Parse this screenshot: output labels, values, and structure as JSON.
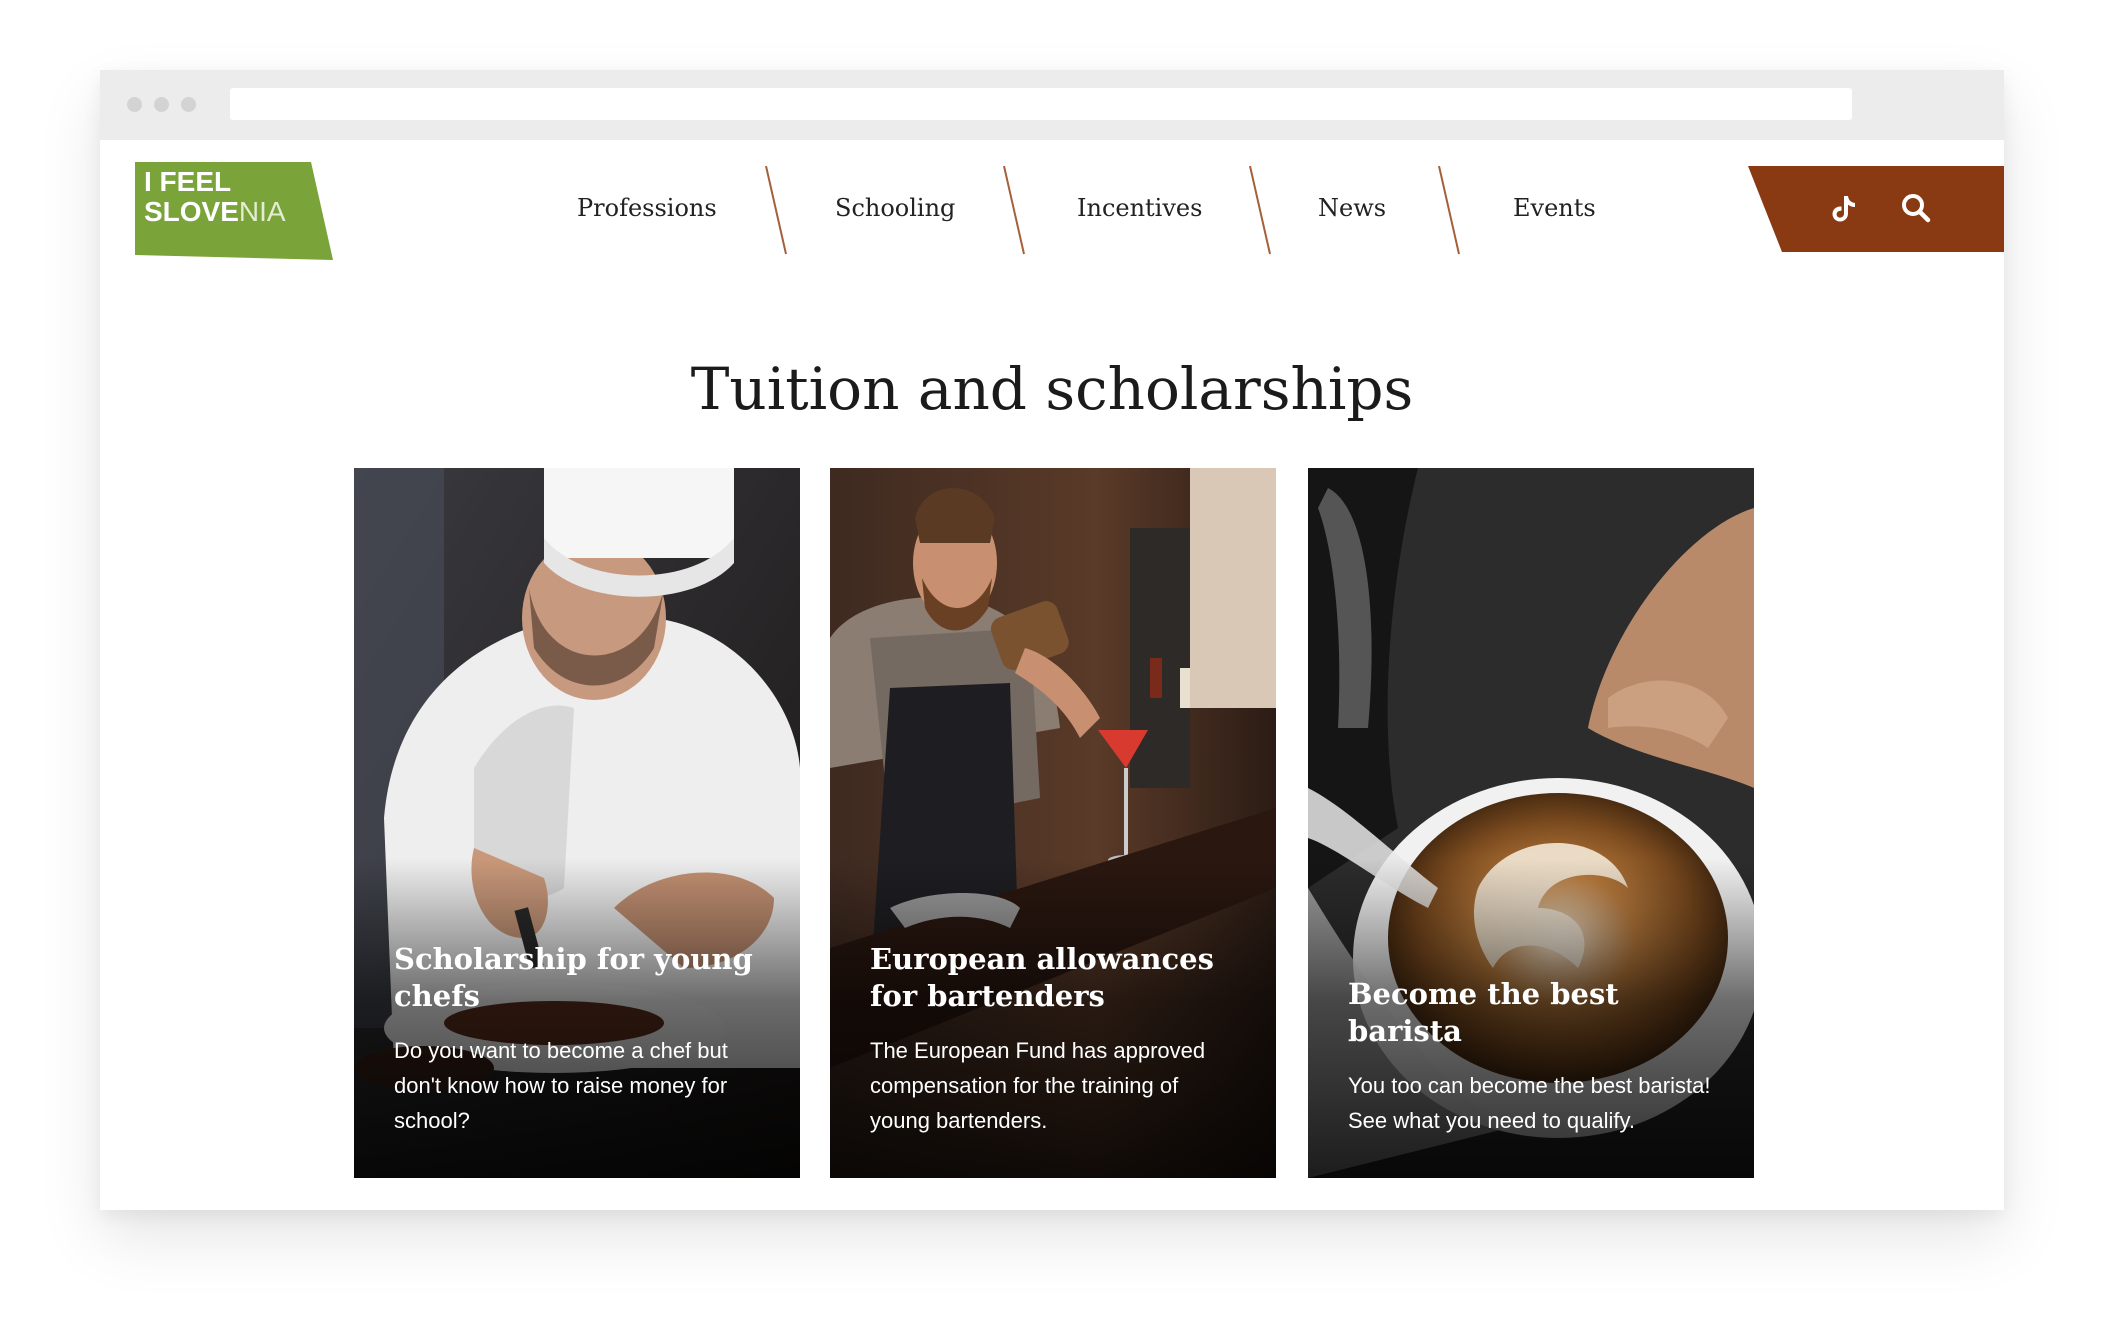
{
  "site": {
    "logo": {
      "line1": "I FEEL",
      "line2_bold": "SLOVE",
      "line2_light": "NIA",
      "color": "#7aa33a"
    },
    "accent_color": "#8a3a12"
  },
  "nav": {
    "items": [
      {
        "label": "Professions"
      },
      {
        "label": "Schooling"
      },
      {
        "label": "Incentives"
      },
      {
        "label": "News"
      },
      {
        "label": "Events"
      }
    ]
  },
  "actions": {
    "tiktok_icon": "tiktok-icon",
    "search_icon": "search-icon"
  },
  "main": {
    "title": "Tuition and scholarships",
    "cards": [
      {
        "title": "Scholarship for young chefs",
        "description": "Do you want to become a chef but don't know how to raise money for school?"
      },
      {
        "title": "European allowances for bartenders",
        "description": "The European Fund has approved compensation for the training of young bartenders."
      },
      {
        "title": "Become the best barista",
        "description": "You too can become the best barista! See what you need to qualify."
      }
    ]
  }
}
